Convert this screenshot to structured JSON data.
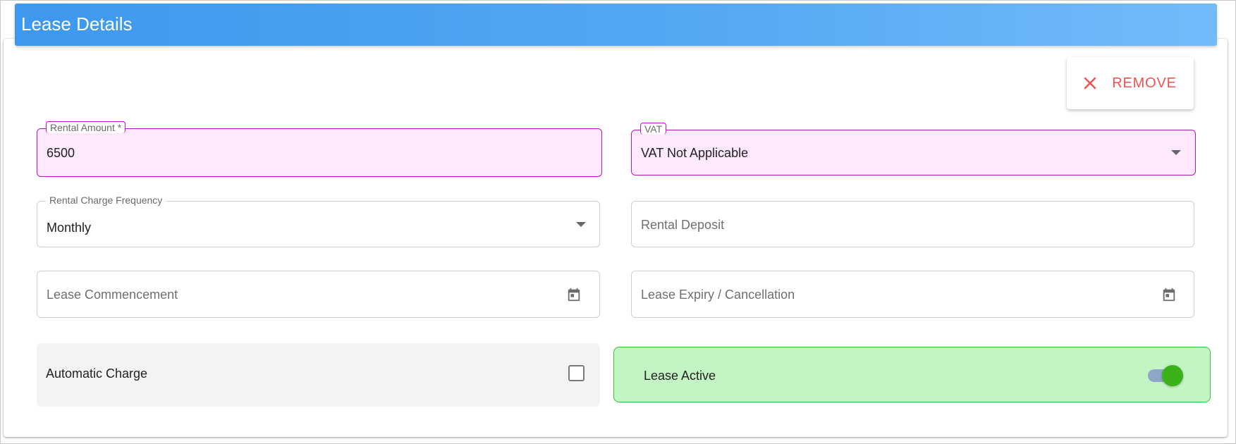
{
  "header": {
    "title": "Lease Details"
  },
  "actions": {
    "remove_label": "REMOVE"
  },
  "rental_amount": {
    "label": "Rental Amount *",
    "value": "6500"
  },
  "vat": {
    "label": "VAT",
    "value": "VAT Not Applicable"
  },
  "rental_charge_frequency": {
    "label": "Rental Charge Frequency",
    "value": "Monthly"
  },
  "rental_deposit": {
    "placeholder": "Rental Deposit"
  },
  "lease_commencement": {
    "placeholder": "Lease Commencement",
    "icon": "calendar-icon"
  },
  "lease_expiry": {
    "placeholder": "Lease Expiry / Cancellation",
    "icon": "calendar-icon"
  },
  "automatic_charge": {
    "label": "Automatic Charge",
    "checked": false
  },
  "lease_active": {
    "label": "Lease Active",
    "on": true
  },
  "colors": {
    "header_gradient_start": "#3d98ee",
    "header_gradient_end": "#72bbf9",
    "remove_red": "#ef5350",
    "focus_border": "#b31bb8",
    "focus_bg": "#fde8fd",
    "active_bg": "#c3f4c3",
    "active_border": "#39c13a",
    "toggle_knob": "#3cb21a"
  }
}
